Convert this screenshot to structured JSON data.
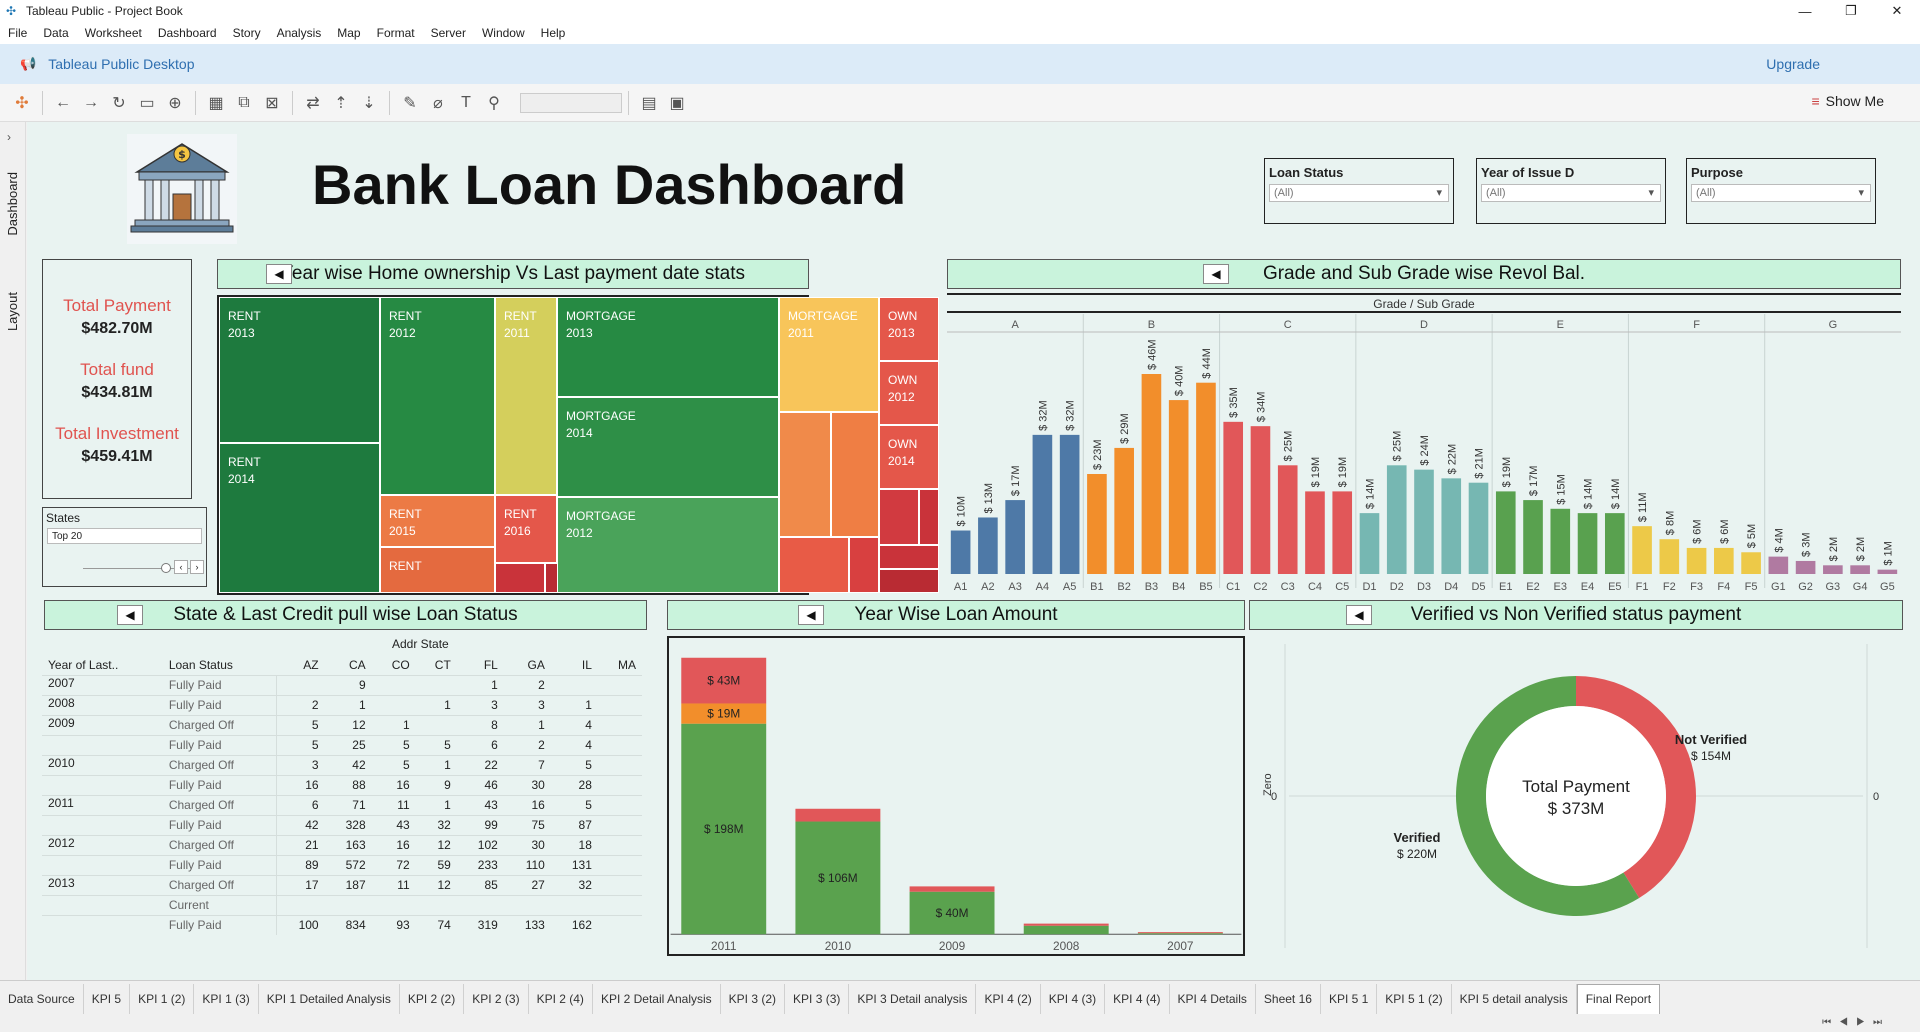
{
  "window": {
    "title": "Tableau Public - Project Book"
  },
  "menu": [
    "File",
    "Data",
    "Worksheet",
    "Dashboard",
    "Story",
    "Analysis",
    "Map",
    "Format",
    "Server",
    "Window",
    "Help"
  ],
  "banner": {
    "text": "Tableau Public Desktop",
    "upgrade": "Upgrade"
  },
  "toolbar": {
    "show_me": "Show Me"
  },
  "left_tabs": {
    "dashboard": "Dashboard",
    "layout": "Layout"
  },
  "dashboard": {
    "title": "Bank Loan Dashboard"
  },
  "filters": [
    {
      "label": "Loan Status",
      "value": "(All)"
    },
    {
      "label": "Year of Issue D",
      "value": "(All)"
    },
    {
      "label": "Purpose",
      "value": "(All)"
    }
  ],
  "kpis": [
    {
      "label": "Total Payment",
      "value": "$482.70M"
    },
    {
      "label": "Total fund",
      "value": "$434.81M"
    },
    {
      "label": "Total Investment",
      "value": "$459.41M"
    }
  ],
  "states_filter": {
    "label": "States",
    "value": "Top 20"
  },
  "panels": {
    "treemap": "Year wise Home ownership Vs Last payment date stats",
    "grade": "Grade and Sub Grade wise Revol Bal.",
    "table": "State & Last Credit pull wise Loan Status",
    "year": "Year Wise Loan Amount",
    "verified": "Verified vs Non Verified status payment"
  },
  "treemap": [
    {
      "label": "RENT",
      "year": "2013",
      "color": "#1e7a3e"
    },
    {
      "label": "RENT",
      "year": "2014",
      "color": "#1e7a3e"
    },
    {
      "label": "RENT",
      "year": "2012",
      "color": "#268a43"
    },
    {
      "label": "RENT",
      "year": "2011",
      "color": "#d4cf5c"
    },
    {
      "label": "RENT",
      "year": "2015",
      "color": "#ec7a45"
    },
    {
      "label": "RENT",
      "year": "2016",
      "color": "#e4574a"
    },
    {
      "label": "RENT",
      "year": "",
      "color": "#e46a3f"
    },
    {
      "label": "MORTGAGE",
      "year": "2013",
      "color": "#268a43"
    },
    {
      "label": "MORTGAGE",
      "year": "2014",
      "color": "#2e8f47"
    },
    {
      "label": "MORTGAGE",
      "year": "2012",
      "color": "#4aa35a"
    },
    {
      "label": "MORTGAGE",
      "year": "2011",
      "color": "#f8c55a"
    },
    {
      "label": "OWN",
      "year": "2013",
      "color": "#e4574a"
    },
    {
      "label": "OWN",
      "year": "2012",
      "color": "#e4574a"
    },
    {
      "label": "OWN",
      "year": "2014",
      "color": "#e4574a"
    }
  ],
  "chart_data": [
    {
      "type": "bar",
      "title": "Grade and Sub Grade wise Revol Bal.",
      "xlabel": "Grade / Sub Grade",
      "groups": [
        "A",
        "B",
        "C",
        "D",
        "E",
        "F",
        "G"
      ],
      "categories": [
        "A1",
        "A2",
        "A3",
        "A4",
        "A5",
        "B1",
        "B2",
        "B3",
        "B4",
        "B5",
        "C1",
        "C2",
        "C3",
        "C4",
        "C5",
        "D1",
        "D2",
        "D3",
        "D4",
        "D5",
        "E1",
        "E2",
        "E3",
        "E4",
        "E5",
        "F1",
        "F2",
        "F3",
        "F4",
        "F5",
        "G1",
        "G2",
        "G3",
        "G4",
        "G5"
      ],
      "values": [
        10,
        13,
        17,
        32,
        32,
        23,
        29,
        46,
        40,
        44,
        35,
        34,
        25,
        19,
        19,
        14,
        25,
        24,
        22,
        21,
        19,
        17,
        15,
        14,
        14,
        11,
        8,
        6,
        6,
        5,
        4,
        3,
        2,
        2,
        1
      ],
      "labels": [
        "$ 10M",
        "$ 13M",
        "$ 17M",
        "$ 32M",
        "$ 32M",
        "$ 23M",
        "$ 29M",
        "$ 46M",
        "$ 40M",
        "$ 44M",
        "$ 35M",
        "$ 34M",
        "$ 25M",
        "$ 19M",
        "$ 19M",
        "$ 14M",
        "$ 25M",
        "$ 24M",
        "$ 22M",
        "$ 21M",
        "$ 19M",
        "$ 17M",
        "$ 15M",
        "$ 14M",
        "$ 14M",
        "$ 11M",
        "$ 8M",
        "$ 6M",
        "$ 6M",
        "$ 5M",
        "$ 4M",
        "$ 3M",
        "$ 2M",
        "$ 2M",
        "$ 1M"
      ],
      "group_colors": {
        "A": "#4e79a7",
        "B": "#f28e2b",
        "C": "#e15759",
        "D": "#76b7b2",
        "E": "#59a14f",
        "F": "#edc948",
        "G": "#b07aa1"
      }
    },
    {
      "type": "bar",
      "title": "Year Wise Loan Amount",
      "categories": [
        "2011",
        "2010",
        "2009",
        "2008",
        "2007"
      ],
      "series": [
        {
          "color": "#5aa24e",
          "values": [
            198,
            106,
            40,
            8,
            1
          ]
        },
        {
          "color": "#f28e2b",
          "values": [
            19,
            0,
            0,
            0,
            0
          ]
        },
        {
          "color": "#e15759",
          "values": [
            43,
            12,
            5,
            2,
            1
          ]
        }
      ],
      "segment_labels": [
        {
          "bar": "2011",
          "text": "$ 198M"
        },
        {
          "bar": "2011",
          "text": "$ 19M"
        },
        {
          "bar": "2011",
          "text": "$ 43M"
        },
        {
          "bar": "2010",
          "text": "$ 106M"
        },
        {
          "bar": "2009",
          "text": "$ 40M"
        }
      ]
    },
    {
      "type": "pie",
      "title": "Verified vs Non Verified status payment",
      "center_label": "Total Payment",
      "center_value": "$ 373M",
      "axis_label": "Zero",
      "axis_tick": "0",
      "slices": [
        {
          "name": "Verified",
          "value": 220,
          "label": "$ 220M",
          "color": "#5aa24e"
        },
        {
          "name": "Not Verified",
          "value": 154,
          "label": "$ 154M",
          "color": "#e15759"
        }
      ]
    }
  ],
  "table": {
    "column_group": "Addr State",
    "row_headers": [
      "Year of Last..",
      "Loan Status"
    ],
    "columns": [
      "AZ",
      "CA",
      "CO",
      "CT",
      "FL",
      "GA",
      "IL",
      "MA"
    ],
    "rows": [
      {
        "year": "2007",
        "status": "Fully Paid",
        "vals": [
          "",
          "9",
          "",
          "",
          "1",
          "2",
          "",
          ""
        ]
      },
      {
        "year": "2008",
        "status": "Fully Paid",
        "vals": [
          "2",
          "1",
          "",
          "1",
          "3",
          "3",
          "1",
          ""
        ]
      },
      {
        "year": "2009",
        "status": "Charged Off",
        "vals": [
          "5",
          "12",
          "1",
          "",
          "8",
          "1",
          "4",
          ""
        ]
      },
      {
        "year": "",
        "status": "Fully Paid",
        "vals": [
          "5",
          "25",
          "5",
          "5",
          "6",
          "2",
          "4",
          ""
        ]
      },
      {
        "year": "2010",
        "status": "Charged Off",
        "vals": [
          "3",
          "42",
          "5",
          "1",
          "22",
          "7",
          "5",
          ""
        ]
      },
      {
        "year": "",
        "status": "Fully Paid",
        "vals": [
          "16",
          "88",
          "16",
          "9",
          "46",
          "30",
          "28",
          ""
        ]
      },
      {
        "year": "2011",
        "status": "Charged Off",
        "vals": [
          "6",
          "71",
          "11",
          "1",
          "43",
          "16",
          "5",
          ""
        ]
      },
      {
        "year": "",
        "status": "Fully Paid",
        "vals": [
          "42",
          "328",
          "43",
          "32",
          "99",
          "75",
          "87",
          ""
        ]
      },
      {
        "year": "2012",
        "status": "Charged Off",
        "vals": [
          "21",
          "163",
          "16",
          "12",
          "102",
          "30",
          "18",
          ""
        ]
      },
      {
        "year": "",
        "status": "Fully Paid",
        "vals": [
          "89",
          "572",
          "72",
          "59",
          "233",
          "110",
          "131",
          ""
        ]
      },
      {
        "year": "2013",
        "status": "Charged Off",
        "vals": [
          "17",
          "187",
          "11",
          "12",
          "85",
          "27",
          "32",
          ""
        ]
      },
      {
        "year": "",
        "status": "Current",
        "vals": [
          "",
          "",
          "",
          "",
          "",
          "",
          "",
          ""
        ]
      },
      {
        "year": "",
        "status": "Fully Paid",
        "vals": [
          "100",
          "834",
          "93",
          "74",
          "319",
          "133",
          "162",
          ""
        ]
      }
    ]
  },
  "sheet_tabs": [
    "Data Source",
    "KPI 5",
    "KPI 1 (2)",
    "KPI 1 (3)",
    "KPI 1 Detailed Analysis",
    "KPI 2 (2)",
    "KPI 2 (3)",
    "KPI 2 (4)",
    "KPI 2 Detail Analysis",
    "KPI 3 (2)",
    "KPI 3 (3)",
    "KPI 3 Detail analysis",
    "KPI 4 (2)",
    "KPI 4 (3)",
    "KPI 4 (4)",
    "KPI 4 Details",
    "Sheet 16",
    "KPI 5 1",
    "KPI 5 1 (2)",
    "KPI 5 detail analysis",
    "Final Report"
  ],
  "active_tab": "Final Report"
}
